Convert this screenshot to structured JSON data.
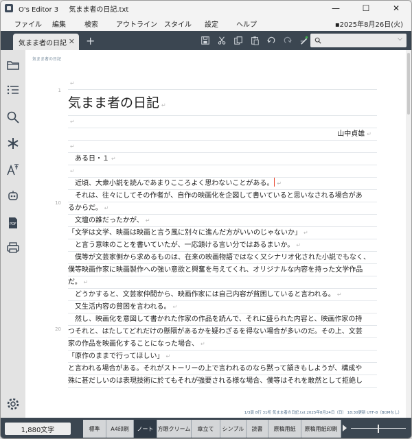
{
  "window": {
    "app_name": "O's Editor 3",
    "file_name": "気まま者の日記.txt",
    "minimize": "—",
    "maximize": "☐",
    "close": "✕"
  },
  "menu": {
    "items": [
      "ファイル",
      "編集",
      "検索",
      "アウトライン",
      "スタイル",
      "設定",
      "ヘルプ"
    ],
    "date": "▪2025年8月26日(火)"
  },
  "tabs": {
    "active_label": "気まま者の日記",
    "close": "✕",
    "add": "+"
  },
  "toolbar": {
    "icons": [
      "save-icon",
      "cut-icon",
      "copy-icon",
      "paste-icon",
      "redo-icon",
      "undo-icon",
      "pen-icon"
    ],
    "search_placeholder": "",
    "search_icon": "search-icon"
  },
  "sidebar": {
    "icons": [
      "folder-icon",
      "outline-list-icon",
      "search-icon",
      "asterisk-icon",
      "font-icon",
      "robot-icon",
      "pdf-icon",
      "print-icon",
      "settings-icon"
    ]
  },
  "editor": {
    "breadcrumb": "気まま者の日記",
    "line_numbers": [
      "1",
      "10",
      "20"
    ],
    "lines": [
      {
        "text": "",
        "kind": "blank"
      },
      {
        "text": "気まま者の日記",
        "kind": "title"
      },
      {
        "text": "",
        "kind": "blank"
      },
      {
        "text": "山中貞雄",
        "kind": "right"
      },
      {
        "text": "",
        "kind": "blank"
      },
      {
        "text": "　ある日・１",
        "kind": "normal"
      },
      {
        "text": "",
        "kind": "blank"
      },
      {
        "text": "　近頃、大衆小説を読んであまりこころよく思わないことがある。",
        "kind": "cursor"
      },
      {
        "text": "　それは、往々にしてその作者が、自作の映画化を企図して書いていると思いなされる場合があ",
        "kind": "wrap"
      },
      {
        "text": "るからだ。",
        "kind": "normal"
      },
      {
        "text": "　文壇の誰だったかが、",
        "kind": "normal"
      },
      {
        "text": "「文学は文学、映画は映画と言う風に別々に進んだ方がいいのじゃないか」",
        "kind": "normal"
      },
      {
        "text": "　と言う意味のことを書いていたが、一応頷ける言い分ではあるまいか。",
        "kind": "normal"
      },
      {
        "text": "　僕等が文芸家側から求めるものは、在来の映画物語ではなく又シナリオ化された小説でもなく、",
        "kind": "wrap"
      },
      {
        "text": "僕等映画作家に映画製作への強い意欲と興奮を与えてくれ、オリジナルな内容を持った文学作品",
        "kind": "wrap"
      },
      {
        "text": "だ。",
        "kind": "normal"
      },
      {
        "text": "　どうかすると、文芸家仲間から、映画作家には自己内容が貧困していると言われる。",
        "kind": "normal"
      },
      {
        "text": "　又生活内容の貧困を言われる。",
        "kind": "normal"
      },
      {
        "text": "　然し、映画化を意図して書かれた作家の作品を読んで、それに盛られた内容と、映画作家の持",
        "kind": "wrap"
      },
      {
        "text": "つそれと、はたしてどれだけの懸隔があるかを疑わざるを得ない場合が多いのだ。その上、文芸",
        "kind": "wrap"
      },
      {
        "text": "家の作品を映画化することになった場合、",
        "kind": "normal"
      },
      {
        "text": "「原作のままで行ってほしい」",
        "kind": "normal"
      },
      {
        "text": "と言われる場合がある。それがストーリーの上で言われるのなら黙って頷きもしようが、構成や",
        "kind": "wrap"
      },
      {
        "text": "殊に甚だしいのは表現技術に於てもそれが強要される様な場合、僕等はそれを敢然として拒絶し",
        "kind": "wrap"
      }
    ],
    "status": "1/3頁 8行 31桁 気まま者の日記.txt 2025年8月24日（日） 18:30更新 UTF-8（BOMなし）"
  },
  "bottom": {
    "char_count": "1,880文字",
    "tabs": [
      "標準",
      "A4印刷",
      "ノート",
      "方眼クリーム",
      "章立て",
      "シンプル",
      "読書",
      "原稿用紙",
      "原稿用紙印刷"
    ],
    "active_tab": "ノート"
  }
}
